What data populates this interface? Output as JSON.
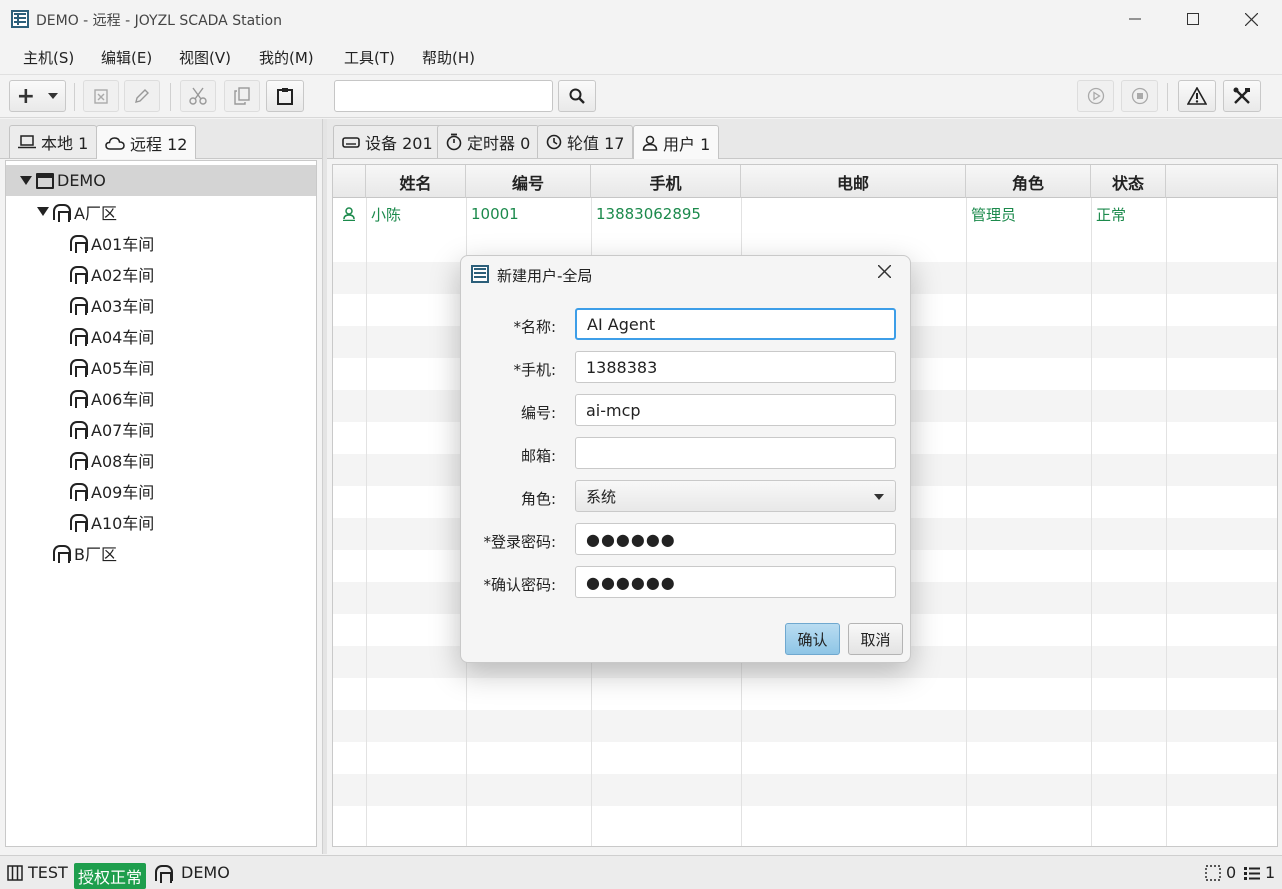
{
  "window": {
    "title": "DEMO - 远程 - JOYZL SCADA Station"
  },
  "menu": [
    "主机(S)",
    "编辑(E)",
    "视图(V)",
    "我的(M)",
    "工具(T)",
    "帮助(H)"
  ],
  "toolbar": {
    "add_label": "+",
    "search_placeholder": ""
  },
  "left_tabs": [
    {
      "label": "本地 1",
      "icon": "laptop-icon"
    },
    {
      "label": "远程 12",
      "icon": "cloud-icon"
    }
  ],
  "tree": {
    "root": "DEMO",
    "area_a": "A厂区",
    "workshops": [
      "A01车间",
      "A02车间",
      "A03车间",
      "A04车间",
      "A05车间",
      "A06车间",
      "A07车间",
      "A08车间",
      "A09车间",
      "A10车间"
    ],
    "area_b": "B厂区"
  },
  "right_tabs": [
    {
      "label": "设备 201",
      "icon": "device-icon"
    },
    {
      "label": "定时器 0",
      "icon": "timer-icon"
    },
    {
      "label": "轮值 17",
      "icon": "clock-icon"
    },
    {
      "label": "用户 1",
      "icon": "user-icon"
    }
  ],
  "table": {
    "columns": [
      "姓名",
      "编号",
      "手机",
      "电邮",
      "角色",
      "状态"
    ],
    "rows": [
      {
        "name": "小陈",
        "id": "10001",
        "phone": "13883062895",
        "email": "",
        "role": "管理员",
        "status": "正常"
      }
    ]
  },
  "dialog": {
    "title": "新建用户-全局",
    "fields": {
      "name_label": "*名称:",
      "name_value": "AI Agent",
      "phone_label": "*手机:",
      "phone_value": "1388383",
      "number_label": "编号:",
      "number_value": "ai-mcp",
      "email_label": "邮箱:",
      "email_value": "",
      "role_label": "角色:",
      "role_value": "系统",
      "password_label": "*登录密码:",
      "password_value": "●●●●●●",
      "confirm_label": "*确认密码:",
      "confirm_value": "●●●●●●"
    },
    "ok_label": "确认",
    "cancel_label": "取消"
  },
  "statusbar": {
    "db_label": "TEST",
    "license": "授权正常",
    "host": "DEMO",
    "selected_count": "0",
    "list_count": "1"
  },
  "colors": {
    "accent_green": "#1c8a4c",
    "badge_green": "#1e9e4d",
    "focus_blue": "#3d9ee8"
  }
}
